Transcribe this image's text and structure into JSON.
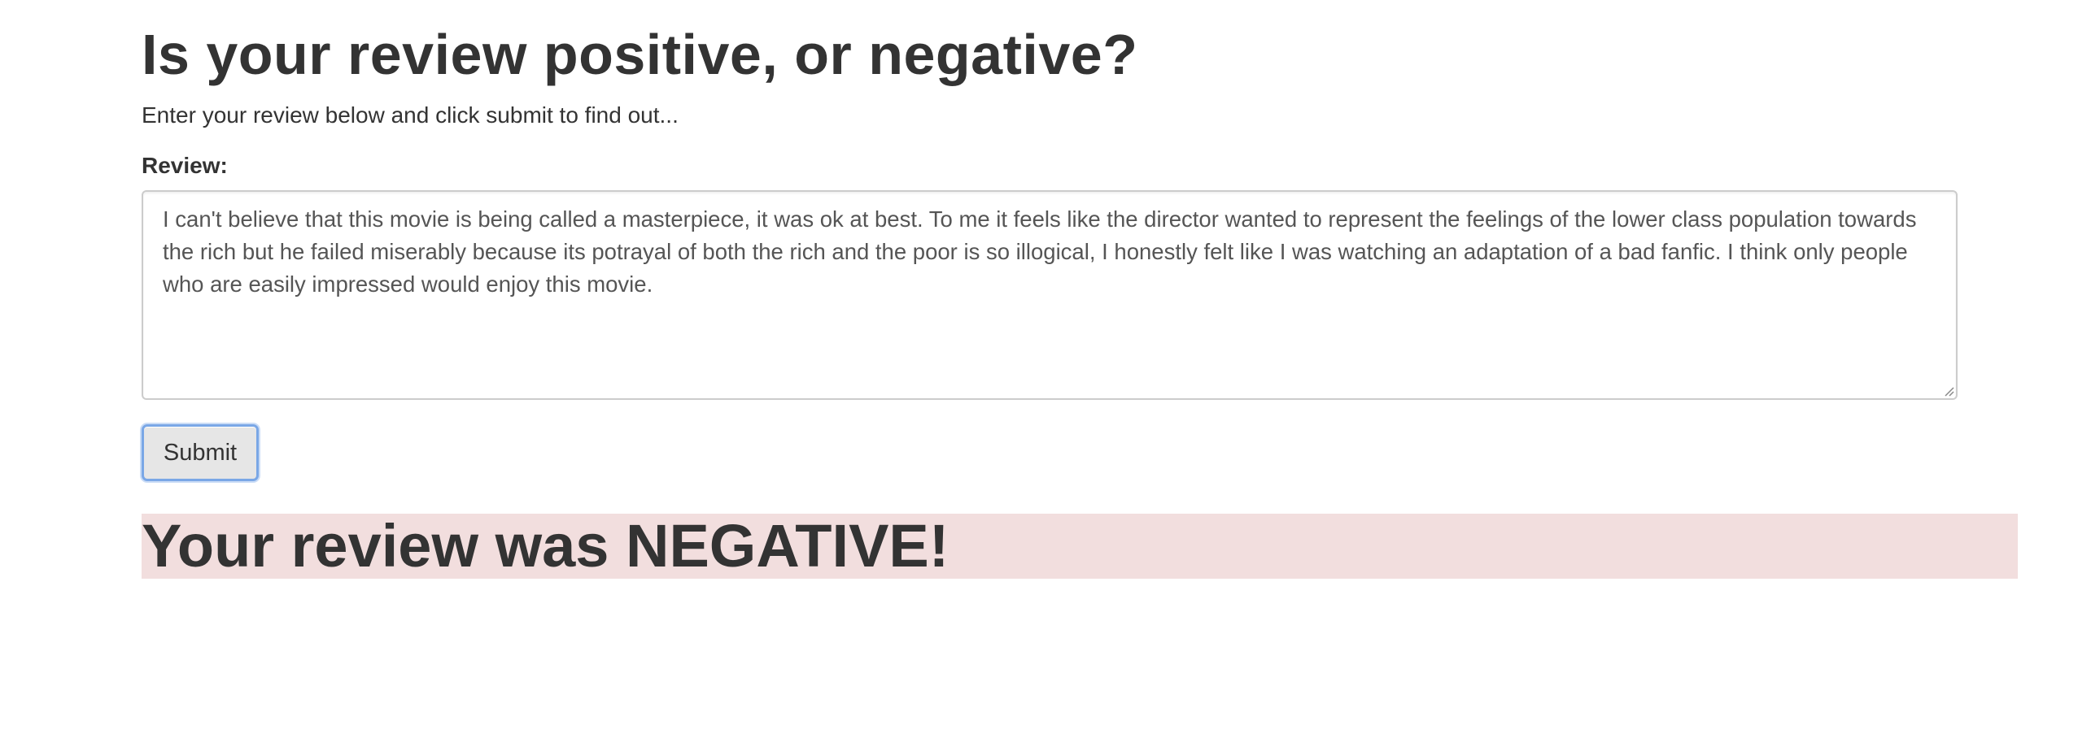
{
  "page": {
    "heading": "Is your review positive, or negative?",
    "intro": "Enter your review below and click submit to find out...",
    "review_label": "Review:"
  },
  "form": {
    "review_value": "I can't believe that this movie is being called a masterpiece, it was ok at best. To me it feels like the director wanted to represent the feelings of the lower class population towards the rich but he failed miserably because its potrayal of both the rich and the poor is so illogical, I honestly felt like I was watching an adaptation of a bad fanfic. I think only people who are easily impressed would enjoy this movie.",
    "submit_label": "Submit"
  },
  "result": {
    "text": "Your review was NEGATIVE!",
    "background_color": "#f2dede",
    "sentiment": "NEGATIVE"
  },
  "colors": {
    "text": "#333333",
    "input_border": "#cccccc",
    "focus_ring": "#7aa7e6",
    "button_bg": "#e6e6e6"
  }
}
